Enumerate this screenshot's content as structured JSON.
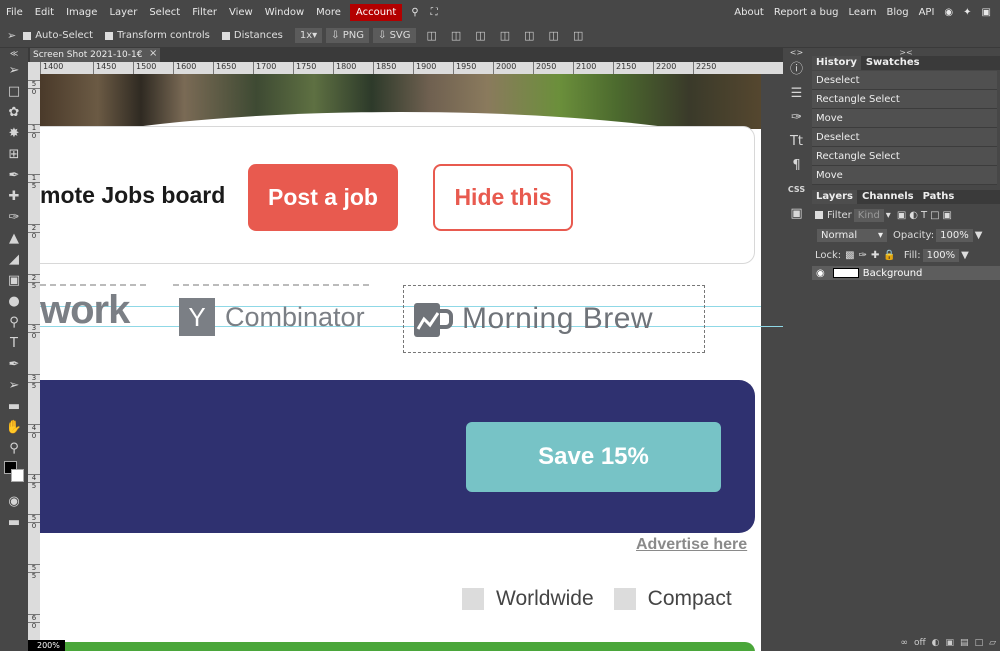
{
  "menu": {
    "items": [
      "File",
      "Edit",
      "Image",
      "Layer",
      "Select",
      "Filter",
      "View",
      "Window",
      "More"
    ],
    "account": "Account",
    "right_links": [
      "About",
      "Report a bug",
      "Learn",
      "Blog",
      "API"
    ]
  },
  "options": {
    "auto_select": "Auto-Select",
    "transform_controls": "Transform controls",
    "distances": "Distances",
    "zoom_select": "1x",
    "png": "PNG",
    "svg": "SVG"
  },
  "document": {
    "tab_title": "Screen Shot 2021-10-1€",
    "close": "×",
    "zoom_level": "200%"
  },
  "ruler": {
    "h_ticks": [
      "1400",
      "1450",
      "1500",
      "1600",
      "1650",
      "1700",
      "1750",
      "1800",
      "1850",
      "1900",
      "1950",
      "2000",
      "2050",
      "2100",
      "2150",
      "2200",
      "2250"
    ],
    "v_ticks": [
      "5",
      "0",
      "1",
      "0",
      "1",
      "5",
      "2",
      "0",
      "2",
      "5",
      "3",
      "0",
      "3",
      "5",
      "4",
      "0",
      "4",
      "5",
      "5",
      "0",
      "5",
      "5",
      "6",
      "0"
    ]
  },
  "canvas": {
    "job_title": "mote Jobs board",
    "post_job": "Post a job",
    "hide_this": "Hide this",
    "logo_work": "work",
    "logo_yc_letter": "Y",
    "logo_yc_text": "Combinator",
    "logo_mb_text": "Morning Brew",
    "save_button": "Save 15%",
    "advertise": "Advertise here",
    "filter_worldwide": "Worldwide",
    "filter_compact": "Compact"
  },
  "panels": {
    "head_left": "<>",
    "head_right": "><",
    "history_tabs": [
      "History",
      "Swatches"
    ],
    "history": [
      "Deselect",
      "Rectangle Select",
      "Move",
      "Deselect",
      "Rectangle Select",
      "Move"
    ],
    "layers_tabs": [
      "Layers",
      "Channels",
      "Paths"
    ],
    "filter_label": "Filter",
    "kind_label": "Kind",
    "blend_mode": "Normal",
    "opacity_label": "Opacity:",
    "opacity_value": "100%",
    "lock_label": "Lock:",
    "fill_label": "Fill:",
    "fill_value": "100%",
    "layer_name": "Background",
    "bottom_off": "off"
  },
  "colors": {
    "accent_red": "#e85a4f",
    "banner_navy": "#2f3170",
    "save_teal": "#77c3c6",
    "account_red": "#b30000"
  }
}
